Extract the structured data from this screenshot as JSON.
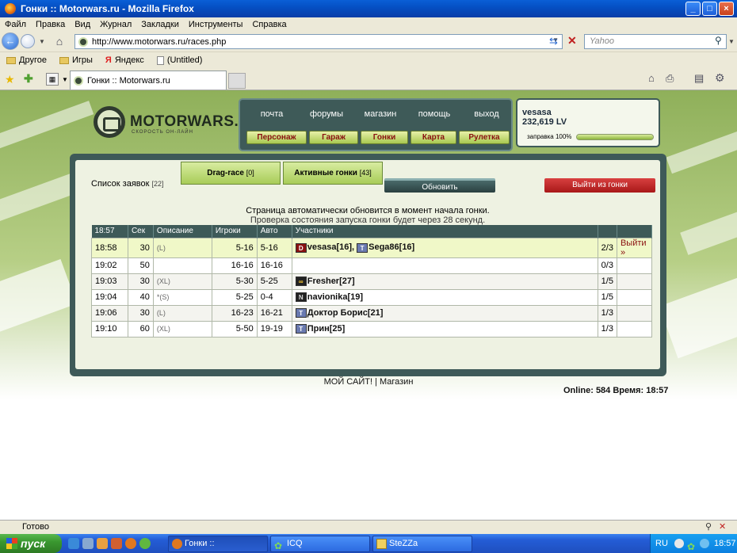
{
  "window": {
    "title": "Гонки :: Motorwars.ru - Mozilla Firefox"
  },
  "menu": [
    "Файл",
    "Правка",
    "Вид",
    "Журнал",
    "Закладки",
    "Инструменты",
    "Справка"
  ],
  "address": {
    "url": "http://www.motorwars.ru/races.php"
  },
  "search": {
    "placeholder": "Yahoo"
  },
  "bookmarks": [
    "Другое",
    "Игры",
    "Яндекс",
    "(Untitled)"
  ],
  "tab": {
    "label": "Гонки :: Motorwars.ru"
  },
  "site": {
    "logo": "MOTORWARS.RU",
    "tagline": "СКОРОСТЬ ОН-ЛАЙН",
    "topnav": [
      "почта",
      "форумы",
      "магазин",
      "помощь",
      "выход"
    ],
    "mainnav": [
      "Персонаж",
      "Гараж",
      "Гонки",
      "Карта",
      "Рулетка"
    ],
    "user": {
      "name": "vesasa",
      "money": "232,619 LV",
      "fuel_label": "заправка 100%",
      "fuel": 1.0
    }
  },
  "panel": {
    "list_label": "Список заявок",
    "list_count": "[22]",
    "drag_label": "Drag-race",
    "drag_count": "[0]",
    "active_label": "Активные гонки",
    "active_count": "[43]",
    "refresh": "Обновить",
    "exit": "Выйти из гонки",
    "notice1": "Страница автоматически обновится в момент начала гонки.",
    "notice2": "Проверка состояния запуска гонки будет через 28 секунд."
  },
  "table": {
    "headers": [
      "18:57",
      "Сек",
      "Описание",
      "Игроки",
      "Авто",
      "Участники",
      "",
      ""
    ],
    "rows": [
      {
        "time": "18:58",
        "sec": "30",
        "desc": "(L)",
        "players": "5-16",
        "auto": "5-16",
        "participants": [
          {
            "badge": "D",
            "name": "vesasa[16],"
          },
          {
            "badge": "T",
            "name": "Sega86[16]"
          }
        ],
        "ratio": "2/3",
        "action": "Выйти »"
      },
      {
        "time": "19:02",
        "sec": "50",
        "desc": "",
        "players": "16-16",
        "auto": "16-16",
        "participants": [],
        "ratio": "0/3",
        "action": ""
      },
      {
        "time": "19:03",
        "sec": "30",
        "desc": "(XL)",
        "players": "5-30",
        "auto": "5-25",
        "participants": [
          {
            "badge": "∞",
            "name": "Fresher[27]"
          }
        ],
        "ratio": "1/5",
        "action": ""
      },
      {
        "time": "19:04",
        "sec": "40",
        "desc": "*(S)",
        "players": "5-25",
        "auto": "0-4",
        "participants": [
          {
            "badge": "N",
            "name": "navionika[19]"
          }
        ],
        "ratio": "1/5",
        "action": ""
      },
      {
        "time": "19:06",
        "sec": "30",
        "desc": "(L)",
        "players": "16-23",
        "auto": "16-21",
        "participants": [
          {
            "badge": "T",
            "name": "Доктор Борис[21]"
          }
        ],
        "ratio": "1/3",
        "action": ""
      },
      {
        "time": "19:10",
        "sec": "60",
        "desc": "(XL)",
        "players": "5-50",
        "auto": "19-19",
        "participants": [
          {
            "badge": "T",
            "name": "Прин[25]"
          }
        ],
        "ratio": "1/3",
        "action": ""
      }
    ]
  },
  "footer": {
    "links": "МОЙ САЙТ! | Магазин",
    "online": "Online: 584  Время: 18:57"
  },
  "status": {
    "text": "Готово"
  },
  "taskbar": {
    "start": "пуск",
    "tasks": [
      "Гонки :: Motorwars.r...",
      "ICQ",
      "SteZZa"
    ],
    "lang": "RU",
    "clock": "18:57"
  }
}
